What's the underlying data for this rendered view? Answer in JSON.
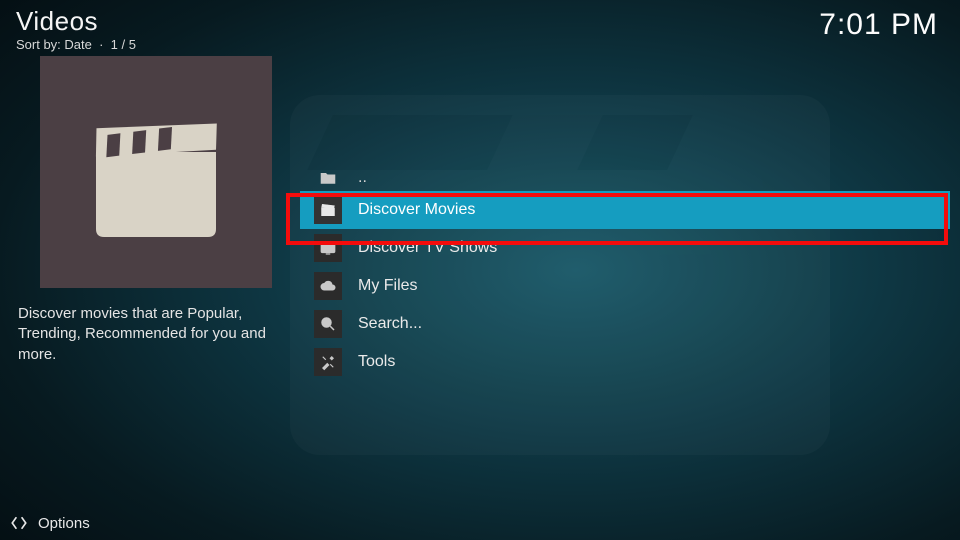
{
  "header": {
    "title": "Videos",
    "sort_label": "Sort by: Date",
    "position": "1 / 5"
  },
  "clock": "7:01 PM",
  "sidebar": {
    "description": "Discover movies that are Popular, Trending, Recommended for you and more."
  },
  "menu": {
    "parent": {
      "icon": "folder-up-icon",
      "label": ".."
    },
    "items": [
      {
        "icon": "clapper-icon",
        "label": "Discover Movies",
        "selected": true
      },
      {
        "icon": "tv-icon",
        "label": "Discover TV Shows"
      },
      {
        "icon": "cloud-icon",
        "label": "My Files"
      },
      {
        "icon": "search-icon",
        "label": "Search..."
      },
      {
        "icon": "tools-icon",
        "label": "Tools"
      }
    ]
  },
  "footer": {
    "options_label": "Options"
  }
}
